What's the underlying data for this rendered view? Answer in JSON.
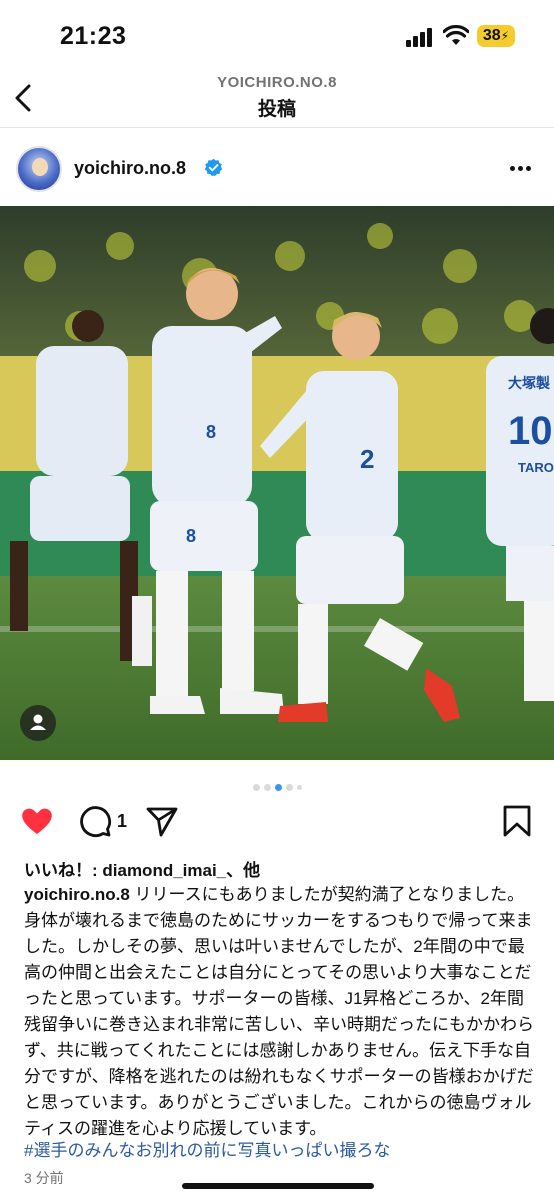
{
  "status_bar": {
    "time": "21:23",
    "battery": "38"
  },
  "nav": {
    "account": "YOICHIRO.NO.8",
    "title": "投稿",
    "icons": [
      "chevron-left-icon"
    ]
  },
  "post": {
    "username": "yoichiro.no.8",
    "verified": true,
    "more_icon": "ellipsis-icon",
    "photo": {
      "jersey_numbers": [
        "8",
        "10",
        "2"
      ],
      "jersey_name": "TARO",
      "sponsor_text": "大塚製",
      "field_color": "#4a7a34",
      "kit_color": "#e8eef7"
    },
    "carousel": {
      "count": 5,
      "active_index": 2
    },
    "actions": {
      "like_icon": "heart-filled-icon",
      "comment_icon": "comment-icon",
      "share_icon": "send-icon",
      "save_icon": "bookmark-icon",
      "comment_count": "1",
      "like_color": "#ff3040"
    },
    "likes_text": "いいね！: diamond_imai_、他",
    "caption_user": "yoichiro.no.8",
    "caption_text": "リリースにもありましたが契約満了となりました。身体が壊れるまで徳島のためにサッカーをするつもりで帰って来ました。しかしその夢、思いは叶いませんでしたが、2年間の中で最高の仲間と出会えたことは自分にとってその思いより大事なことだったと思っています。サポーターの皆様、J1昇格どころか、2年間残留争いに巻き込まれ非常に苦しい、辛い時期だったにもかかわらず、共に戦ってくれたことには感謝しかありません。伝え下手な自分ですが、降格を逃れたのは紛れもなくサポーターの皆様おかげだと思っています。ありがとうございました。これからの徳島ヴォルティスの躍進を心より応援しています。",
    "hashtag": "#選手のみんなお別れの前に写真いっぱい撮ろな",
    "time_ago": "3 分前"
  }
}
